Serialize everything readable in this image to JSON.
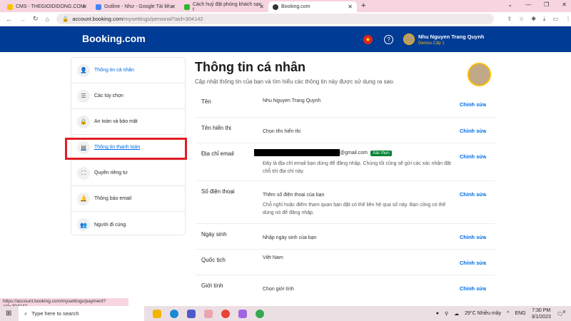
{
  "browser": {
    "tabs": [
      {
        "label": "CMS - THEGIOIDIDONG.COM",
        "color": "#f5c400"
      },
      {
        "label": "Outline - Như - Google Tài liệu",
        "color": "#4285f4"
      },
      {
        "label": "Cách huỷ đặt phòng khách sạn t",
        "color": "#2eb82e"
      },
      {
        "label": "Booking.com",
        "color": "#333333"
      }
    ],
    "url_host": "account.booking.com",
    "url_path": "/mysettings/personal?aid=304142"
  },
  "header": {
    "logo": "Booking.com",
    "user_name": "Nhu Nguyen Trang Quynh",
    "genius": "Genius Cấp 1"
  },
  "sidebar": {
    "items": [
      {
        "label": "Thông tin cá nhân",
        "icon": "👤"
      },
      {
        "label": "Các tùy chọn",
        "icon": "☰"
      },
      {
        "label": "An toàn và bảo mật",
        "icon": "🔒"
      },
      {
        "label": "Thông tin thanh toán",
        "icon": "▤"
      },
      {
        "label": "Quyền riêng tư",
        "icon": "⛶"
      },
      {
        "label": "Thông báo email",
        "icon": "🔔"
      },
      {
        "label": "Người đi cùng",
        "icon": "👥"
      }
    ]
  },
  "main": {
    "title": "Thông tin cá nhân",
    "subtitle": "Cập nhật thông tin của bạn và tìm hiểu các thông tin này được sử dụng ra sao.",
    "edit_label": "Chỉnh sửa",
    "rows": [
      {
        "label": "Tên",
        "value": "Nhu Nguyen Trang Quynh"
      },
      {
        "label": "Tên hiển thị",
        "value": "Chọn tên hiển thị"
      },
      {
        "label": "Địa chỉ email",
        "value": "@gmail.com",
        "badge": "Xác thực",
        "note": "Đây là địa chỉ email bạn dùng để đăng nhập. Chúng tôi cũng sẽ gửi các xác nhận đặt chỗ tới địa chỉ này."
      },
      {
        "label": "Số điện thoại",
        "value": "Thêm số điện thoại của bạn",
        "note": "Chỗ nghỉ hoặc điểm tham quan bạn đặt có thể liên hệ qua số này. Bạn cũng có thể dùng nó để đăng nhập."
      },
      {
        "label": "Ngày sinh",
        "value": "Nhập ngày sinh của bạn"
      },
      {
        "label": "Quốc tịch",
        "value": "Việt Nam"
      },
      {
        "label": "Giới tính",
        "value": "Chọn giới tính"
      }
    ]
  },
  "status_url": "https://account.booking.com/mysettings/payment?aid=304142",
  "taskbar": {
    "search_placeholder": "Type here to search",
    "weather": "29°C  Nhiều mây",
    "lang": "ENG",
    "time": "7:30 PM",
    "date": "3/1/2023",
    "notifications": "8"
  }
}
